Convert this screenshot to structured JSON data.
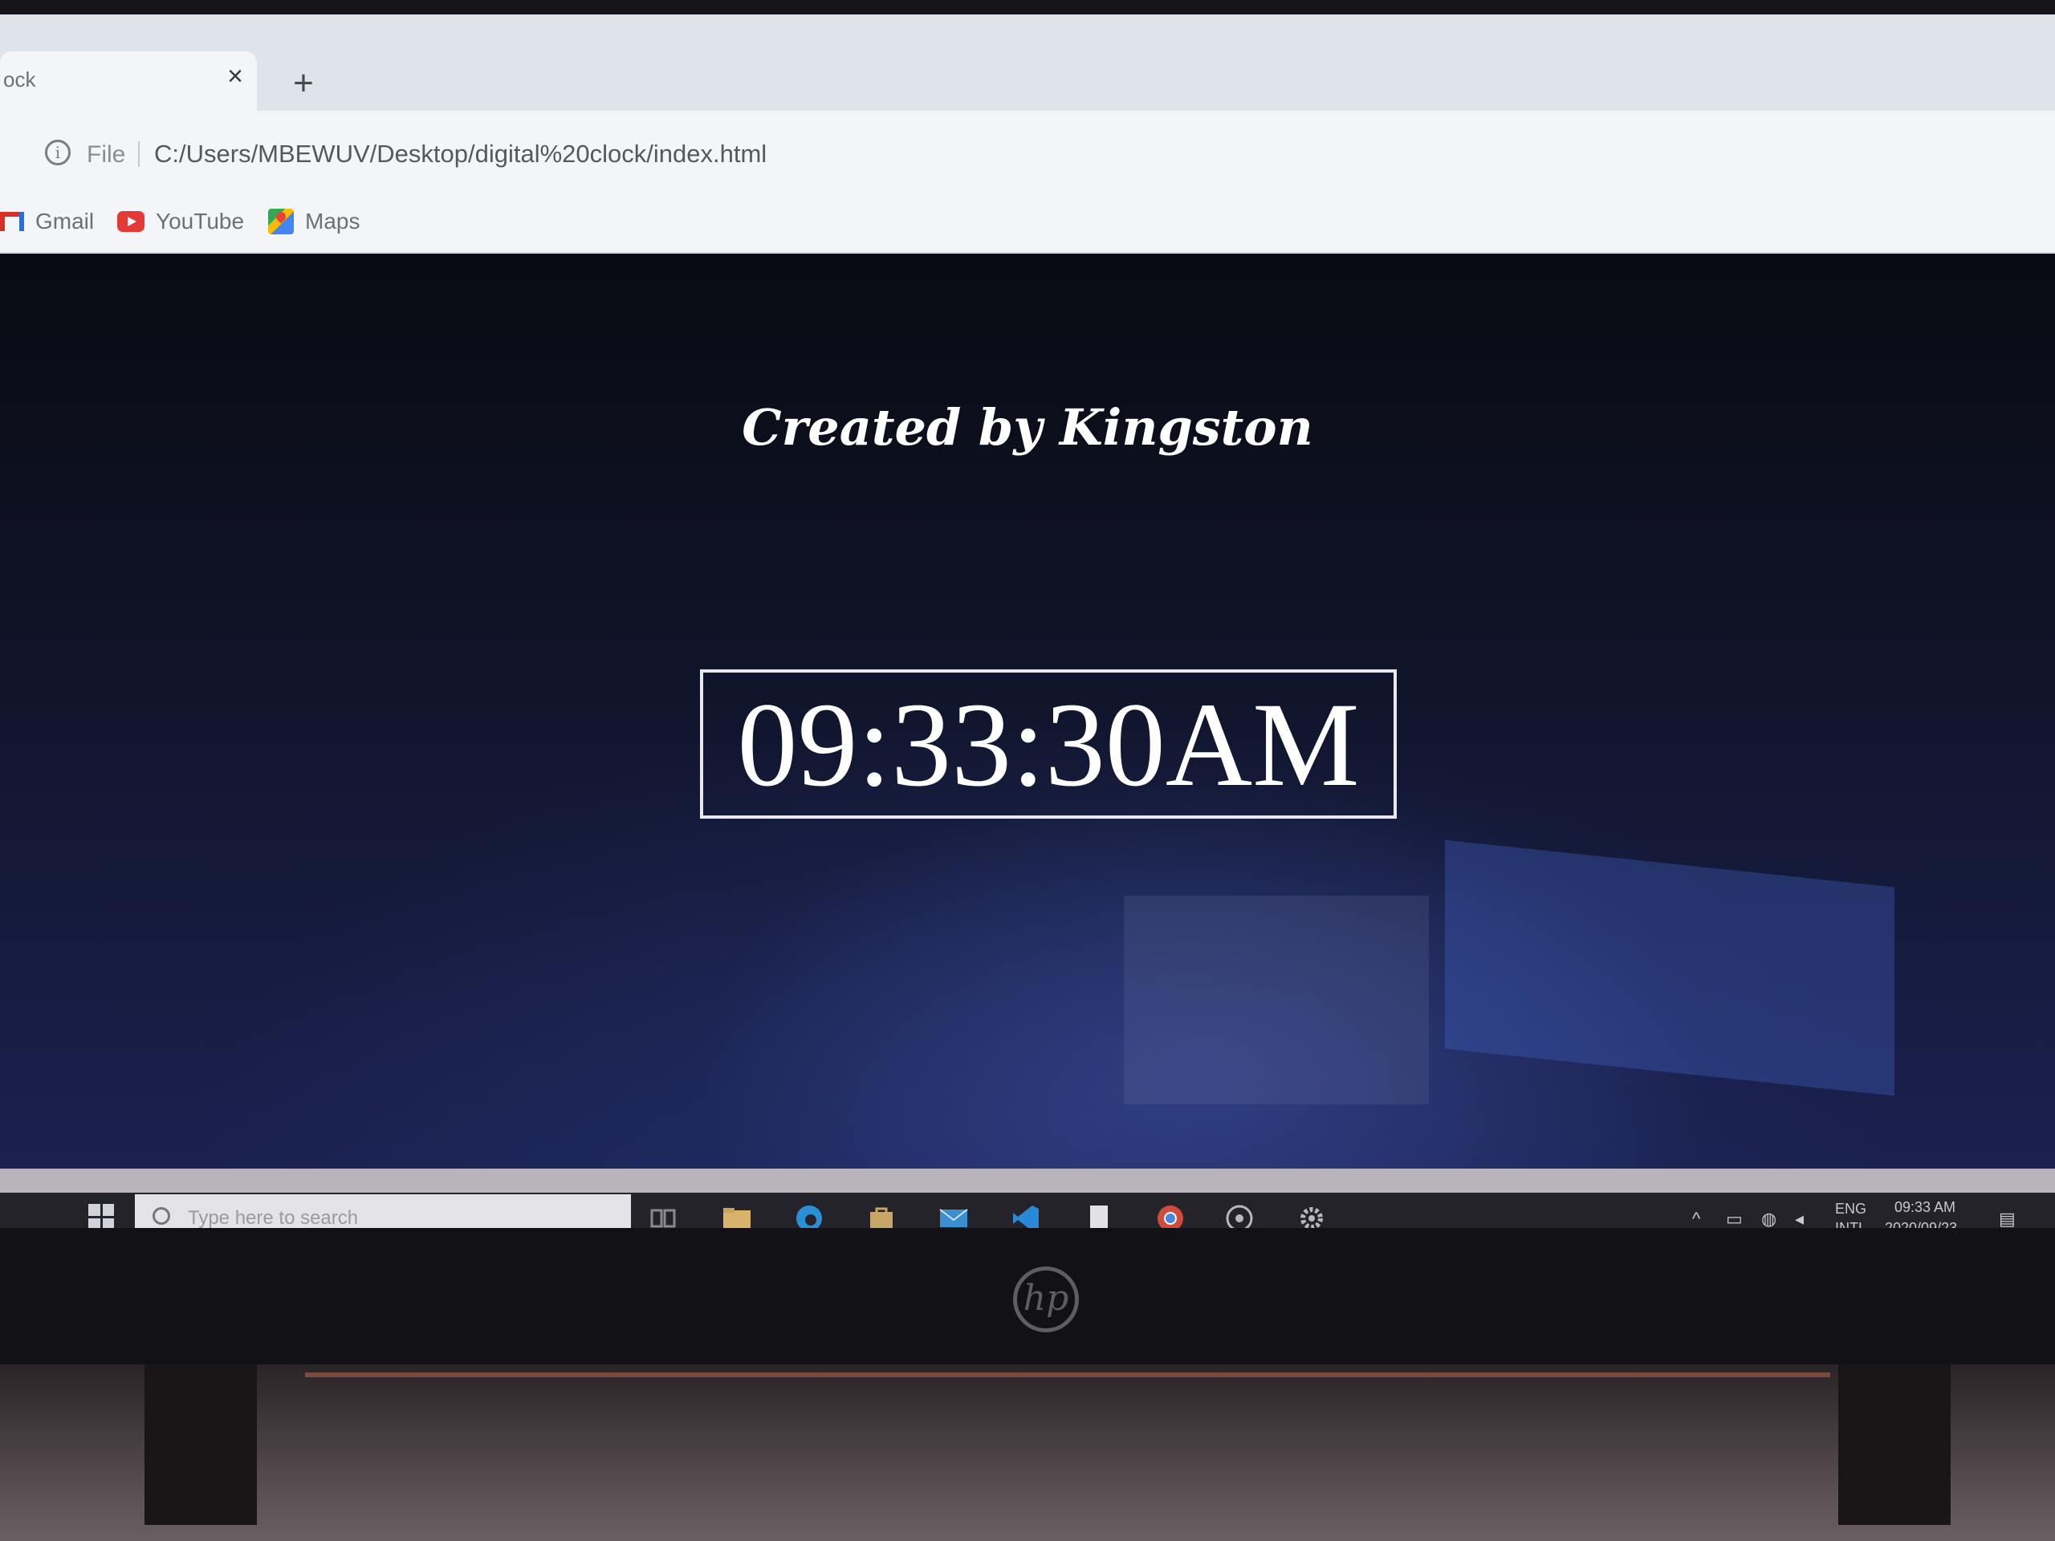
{
  "browser": {
    "tab": {
      "title": "ock",
      "close_glyph": "×"
    },
    "new_tab_glyph": "+",
    "address": {
      "scheme_label": "File",
      "url": "C:/Users/MBEWUV/Desktop/digital%20clock/index.html"
    },
    "bookmarks": [
      {
        "label": "Gmail",
        "icon": "gmail-icon"
      },
      {
        "label": "YouTube",
        "icon": "youtube-icon"
      },
      {
        "label": "Maps",
        "icon": "maps-icon"
      }
    ]
  },
  "page": {
    "credit": "Created by Kingston",
    "clock": "09:33:30AM"
  },
  "taskbar": {
    "search_placeholder": "Type here to search",
    "tray": {
      "language": "ENG",
      "layout": "INTL",
      "time": "09:33 AM",
      "date": "2020/09/23"
    }
  },
  "device": {
    "logo": "hp"
  },
  "colors": {
    "page_background": "#0d1120",
    "clock_text": "#ffffff",
    "clock_border": "#e8e8ee"
  }
}
